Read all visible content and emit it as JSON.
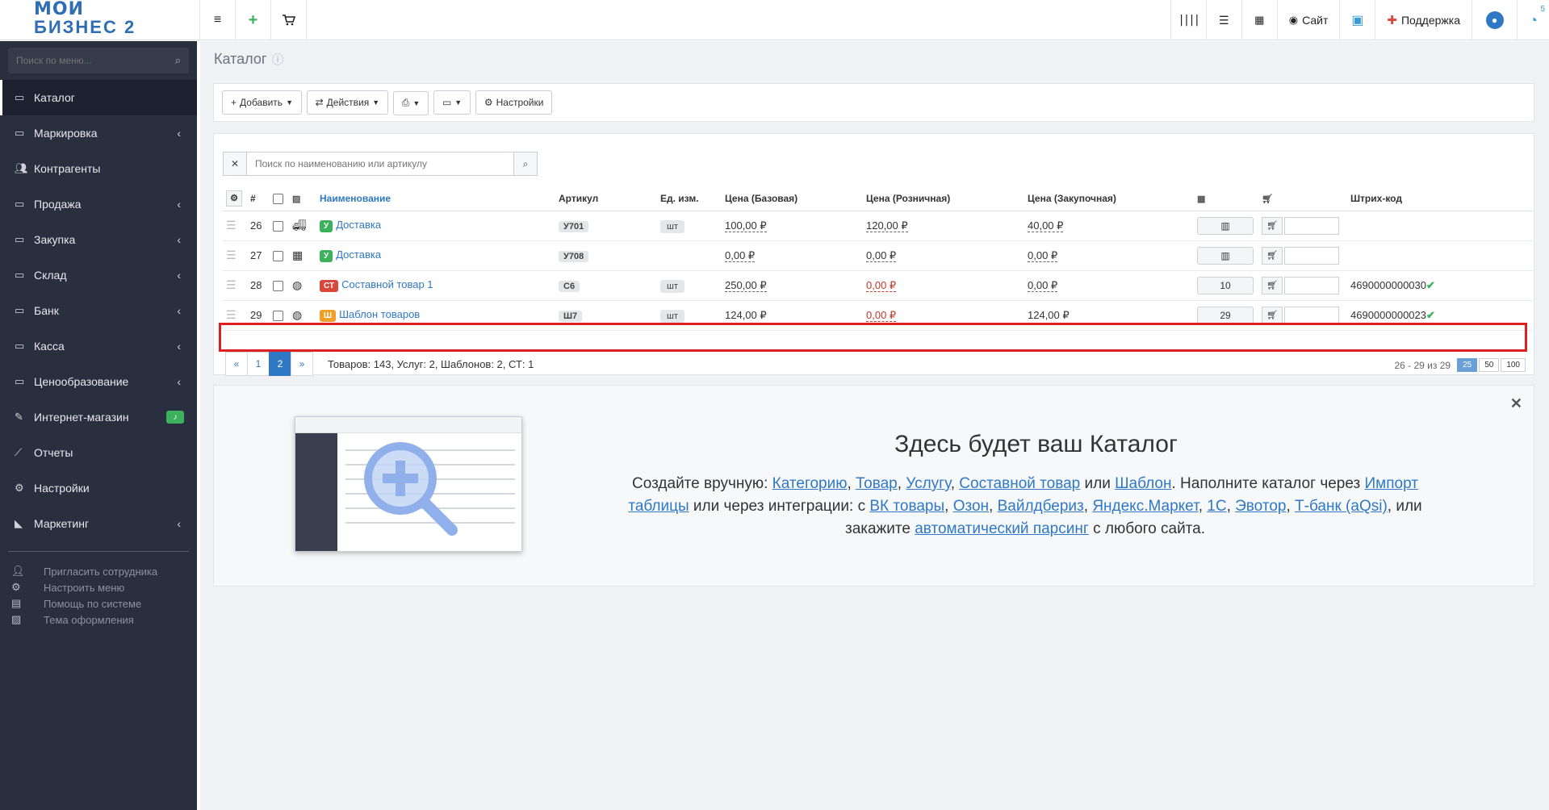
{
  "logo": {
    "line1": "МОЙ",
    "line2": "БИЗНЕС 2"
  },
  "topbar": {
    "site_label": "Сайт",
    "support_label": "Поддержка",
    "notif_count": "5"
  },
  "sidebar": {
    "search_placeholder": "Поиск по меню...",
    "items": [
      {
        "label": "Каталог",
        "icon": "folder-icon",
        "active": true
      },
      {
        "label": "Маркировка",
        "icon": "folder-icon",
        "chevron": true
      },
      {
        "label": "Контрагенты",
        "icon": "users-icon"
      },
      {
        "label": "Продажа",
        "icon": "folder-icon",
        "chevron": true
      },
      {
        "label": "Закупка",
        "icon": "folder-icon",
        "chevron": true
      },
      {
        "label": "Склад",
        "icon": "folder-icon",
        "chevron": true
      },
      {
        "label": "Банк",
        "icon": "folder-icon",
        "chevron": true
      },
      {
        "label": "Касса",
        "icon": "folder-icon",
        "chevron": true
      },
      {
        "label": "Ценообразование",
        "icon": "folder-icon",
        "chevron": true
      },
      {
        "label": "Интернет-магазин",
        "icon": "magic-icon",
        "bell": true
      },
      {
        "label": "Отчеты",
        "icon": "chart-line-icon"
      },
      {
        "label": "Настройки",
        "icon": "gear-icon"
      },
      {
        "label": "Маркетинг",
        "icon": "chart-area-icon",
        "chevron": true
      }
    ],
    "bottom": [
      {
        "label": "Пригласить сотрудника",
        "icon": "user-plus-icon"
      },
      {
        "label": "Настроить меню",
        "icon": "gears-icon"
      },
      {
        "label": "Помощь по системе",
        "icon": "book-icon"
      },
      {
        "label": "Тема оформления",
        "icon": "image-icon"
      }
    ]
  },
  "page": {
    "title": "Каталог"
  },
  "toolbar": {
    "add": "Добавить",
    "actions": "Действия",
    "settings": "Настройки"
  },
  "search": {
    "placeholder": "Поиск по наименованию или артикулу"
  },
  "table": {
    "headers": [
      "#",
      "Наименование",
      "Артикул",
      "Ед. изм.",
      "Цена (Базовая)",
      "Цена (Розничная)",
      "Цена (Закупочная)",
      "Штрих-код"
    ],
    "rows": [
      {
        "num": "26",
        "badge": "У",
        "name": "Доставка",
        "sku": "У701",
        "unit": "шт",
        "base": "100,00 ₽",
        "retail": "120,00 ₽",
        "purchase": "40,00 ₽",
        "stock": "",
        "barcode": ""
      },
      {
        "num": "27",
        "badge": "У",
        "name": "Доставка",
        "sku": "У708",
        "unit": "",
        "base": "0,00 ₽",
        "retail": "0,00 ₽",
        "purchase": "0,00 ₽",
        "stock": "",
        "barcode": ""
      },
      {
        "num": "28",
        "badge": "СТ",
        "name": "Составной товар 1",
        "sku": "С6",
        "unit": "шт",
        "base": "250,00 ₽",
        "retail": "0,00 ₽",
        "purchase": "0,00 ₽",
        "stock": "10",
        "barcode": "4690000000030"
      },
      {
        "num": "29",
        "badge": "Ш",
        "name": "Шаблон товаров",
        "sku": "Ш7",
        "unit": "шт",
        "base": "124,00 ₽",
        "retail": "0,00 ₽",
        "purchase": "124,00 ₽",
        "stock": "29",
        "barcode": "4690000000023"
      }
    ]
  },
  "pager": {
    "prev": "«",
    "p1": "1",
    "p2": "2",
    "next": "»",
    "summary": "Товаров: 143, Услуг: 2, Шаблонов: 2, СТ: 1",
    "range": "26 - 29",
    "of": "из",
    "total": "29",
    "sizes": [
      "25",
      "50",
      "100"
    ]
  },
  "empty_state": {
    "title": "Здесь будет ваш Каталог",
    "t1": "Создайте вручную: ",
    "l_category": "Категорию",
    "l_product": "Товар",
    "l_service": "Услугу",
    "l_composite": "Составной товар",
    "t_or": " или ",
    "l_template": "Шаблон",
    "t2": ". Наполните каталог через ",
    "l_import": "Импорт таблицы",
    "t3": " или через интеграции: с ",
    "l_vk": "ВК товары",
    "l_ozon": "Озон",
    "l_wb": "Вайлдбериз",
    "l_ym": "Яндекс.Маркет",
    "l_1c": "1С",
    "l_evotor": "Эвотор",
    "l_tbank": "Т-банк (aQsi)",
    "t4": ", или закажите ",
    "l_parsing": "автоматический парсинг",
    "t5": " с любого сайта."
  }
}
